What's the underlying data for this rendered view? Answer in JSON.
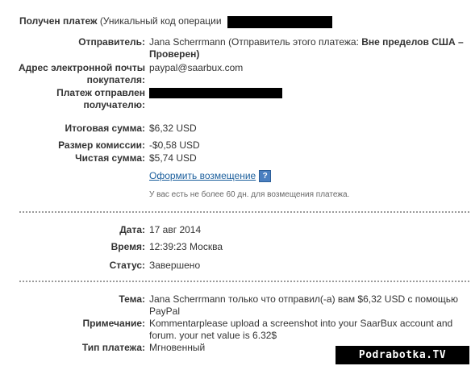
{
  "header": {
    "title_bold": "Получен платеж",
    "title_rest": "(Уникальный код операции"
  },
  "sender": {
    "label": "Отправитель:",
    "name": "Jana Scherrmann",
    "status_prefix": "(Отправитель этого платежа:",
    "status_bold": "Вне пределов США – Проверен)"
  },
  "buyer_email": {
    "label_line1": "Адрес электронной почты",
    "label_line2": "покупателя:",
    "value": "paypal@saarbux.com"
  },
  "sent_to": {
    "label_line1": "Платеж отправлен",
    "label_line2": "получателю:"
  },
  "amounts": {
    "total_label": "Итоговая сумма:",
    "total_value": "$6,32 USD",
    "fee_label": "Размер комиссии:",
    "fee_value": "-$0,58 USD",
    "net_label": "Чистая сумма:",
    "net_value": "$5,74 USD",
    "refund_link": "Оформить возмещение",
    "help_glyph": "?",
    "refund_note": "У вас есть не более 60 дн. для возмещения платежа."
  },
  "meta": {
    "date_label": "Дата:",
    "date_value": "17 авг 2014",
    "time_label": "Время:",
    "time_value": "12:39:23 Москва",
    "status_label": "Статус:",
    "status_value": "Завершено"
  },
  "details": {
    "subject_label": "Тема:",
    "subject_value": "Jana Scherrmann только что отправил(-а) вам $6,32 USD с помощью PayPal",
    "note_label": "Примечание:",
    "note_value": "Kommentarplease upload a screenshot into your SaarBux account and forum. your net value is 6.32$",
    "type_label": "Тип платежа:",
    "type_value": "Мгновенный"
  },
  "watermark": "Podrabotka.TV",
  "icons": {
    "help": "help-icon"
  },
  "colors": {
    "link": "#1a5e9c",
    "help_icon": "#4a7fc0",
    "divider": "#9a9a9a",
    "redaction": "#000000"
  }
}
